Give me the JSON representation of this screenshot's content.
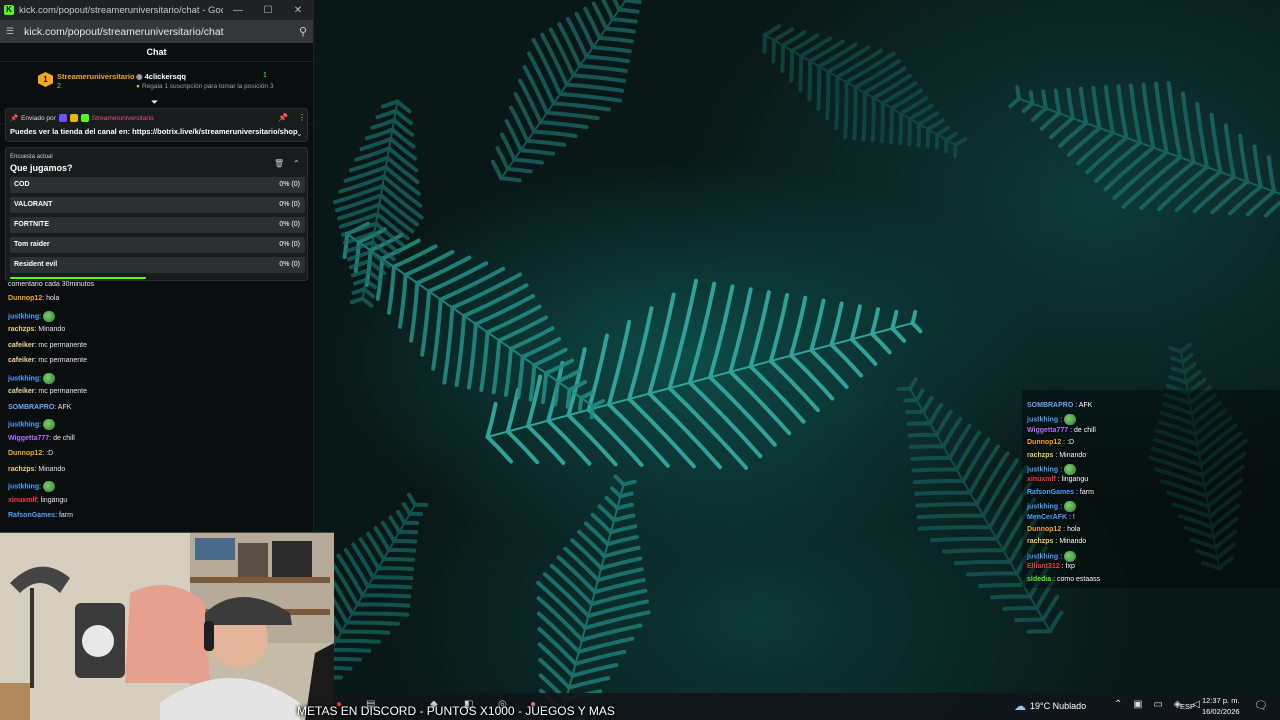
{
  "browser": {
    "window_title": "kick.com/popout/streameruniversitario/chat - Google C...",
    "url": "kick.com/popout/streameruniversitario/chat",
    "window_controls": [
      "—",
      "☐",
      "✕"
    ]
  },
  "chat": {
    "header": "Chat",
    "leaderboard": {
      "rank": "1",
      "top_user": "Streameruniversitario",
      "top_count": "2",
      "gift_user": "4clickersqq",
      "gift_count": "1",
      "gift_hint": "Regala 1 suscripción para tomar la posición 3"
    },
    "pinned": {
      "sent_by_label": "Enviado por",
      "sender": "Streameruniversitario",
      "message": "Puedes ver la tienda del canal en: https://botrix.live/k/streameruniversitario/shop"
    },
    "poll": {
      "label": "Encuesta actual",
      "question": "Que jugamos?",
      "options": [
        {
          "label": "COD",
          "result": "0% (0)"
        },
        {
          "label": "VALORANT",
          "result": "0% (0)"
        },
        {
          "label": "FORTNITE",
          "result": "0% (0)"
        },
        {
          "label": "Tom raider",
          "result": "0% (0)"
        },
        {
          "label": "Resident evil",
          "result": "0% (0)"
        }
      ],
      "time_remaining_fraction": 0.46
    },
    "partial_top_line": {
      "user": "Dunnop12",
      "text": "hola"
    },
    "partial_line": {
      "user": "",
      "text": "comentario cada 30minutos"
    },
    "messages": [
      {
        "user": "Dunnop12",
        "text": "hola",
        "color": "#f5a623"
      },
      {
        "user": "justkhing",
        "text": "",
        "emote": true,
        "color": "#4aa3ff"
      },
      {
        "user": "rachzps",
        "text": "Minando",
        "color": "#f0d060"
      },
      {
        "user": "cafeiker",
        "text": "mc permanente",
        "color": "#f0d7a0"
      },
      {
        "user": "cafeiker",
        "text": "mc permanente",
        "color": "#f0d7a0"
      },
      {
        "user": "justkhing",
        "text": "",
        "emote": true,
        "color": "#4aa3ff"
      },
      {
        "user": "cafeiker",
        "text": "mc permanente",
        "color": "#f0d7a0"
      },
      {
        "user": "SOMBRAPRO",
        "text": "AFK",
        "color": "#6fa8ff"
      },
      {
        "user": "justkhing",
        "text": "",
        "emote": true,
        "color": "#4aa3ff"
      },
      {
        "user": "Wiggetta777",
        "text": "de chill",
        "color": "#b76cff"
      },
      {
        "user": "Dunnop12",
        "text": ":D",
        "color": "#f5a623"
      },
      {
        "user": "rachzps",
        "text": "Minando",
        "color": "#f0d060"
      },
      {
        "user": "justkhing",
        "text": "",
        "emote": true,
        "color": "#4aa3ff"
      },
      {
        "user": "xinuxmlf",
        "text": "lingangu",
        "color": "#ff3344"
      },
      {
        "user": "RafsonGames",
        "text": "farm",
        "color": "#4aa3ff"
      }
    ]
  },
  "overlay_chat": {
    "messages": [
      {
        "user": "SOMBRAPRO",
        "text": "AFK",
        "color": "#6fa8ff"
      },
      {
        "user": "justkhing",
        "text": "",
        "emote": true,
        "color": "#4aa3ff"
      },
      {
        "user": "Wiggetta777",
        "text": "de chill",
        "color": "#b76cff"
      },
      {
        "user": "Dunnop12",
        "text": ":D",
        "color": "#f5a623"
      },
      {
        "user": "rachzps",
        "text": "Minando",
        "color": "#f0d060"
      },
      {
        "user": "justkhing",
        "text": "",
        "emote": true,
        "color": "#4aa3ff"
      },
      {
        "user": "xinuxmlf",
        "text": "lingangu",
        "color": "#ff3344"
      },
      {
        "user": "RafsonGames",
        "text": "farm",
        "color": "#4aa3ff"
      },
      {
        "user": "justkhing",
        "text": "",
        "emote": true,
        "color": "#4aa3ff"
      },
      {
        "user": "MenCerAFK",
        "text": "!",
        "color": "#4aa3ff"
      },
      {
        "user": "Dunnop12",
        "text": "hola",
        "color": "#f5a623"
      },
      {
        "user": "rachzps",
        "text": "Minando",
        "color": "#f0d060"
      },
      {
        "user": "justkhing",
        "text": "",
        "emote": true,
        "color": "#4aa3ff"
      },
      {
        "user": "Elliant312",
        "text": "fxp",
        "color": "#ff3344"
      },
      {
        "user": "sldedia",
        "text": "como estaass",
        "color": "#53fc18"
      }
    ]
  },
  "taskbar": {
    "ticker": "METAS EN DISCORD - PUNTOS X1000 - JUEGOS Y MAS",
    "weather": "19°C  Nublado",
    "language": "ESP",
    "time": "12:37 p. m.",
    "date": "16/02/2026"
  },
  "colors": {
    "kick_green": "#53fc18",
    "rank_gold": "#f5a623"
  }
}
